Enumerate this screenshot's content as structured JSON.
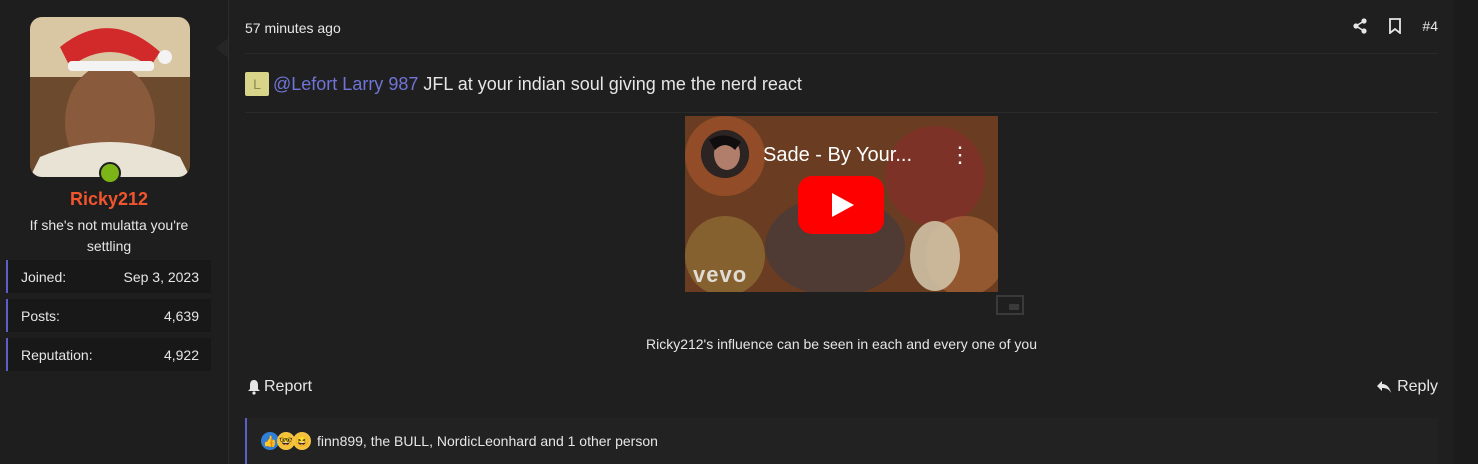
{
  "user": {
    "username": "Ricky212",
    "title": "If she's not mulatta you're settling",
    "stats": [
      {
        "label": "Joined:",
        "value": "Sep 3, 2023"
      },
      {
        "label": "Posts:",
        "value": "4,639"
      },
      {
        "label": "Reputation:",
        "value": "4,922"
      }
    ]
  },
  "post": {
    "timestamp": "57 minutes ago",
    "post_number": "#4",
    "mention_initial": "L",
    "mention_name": "@Lefort Larry 987",
    "message": "JFL at your indian soul giving me the nerd react",
    "video": {
      "title": "Sade - By Your...",
      "watermark": "vevo"
    },
    "signature": "Ricky212's influence can be seen in each and every one of you",
    "report_label": "Report",
    "reply_label": "Reply",
    "reactions_text": "finn899, the BULL, NordicLeonhard and 1 other person"
  },
  "colors": {
    "accent": "#5b5fc7",
    "username": "#f0552d",
    "mention": "#6f74d6",
    "online": "#7cb518"
  }
}
